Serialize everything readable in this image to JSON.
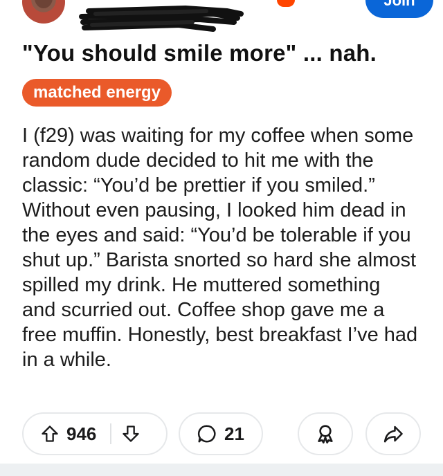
{
  "header": {
    "join_label": "Join"
  },
  "post": {
    "title": "\"You should smile more\" ... nah.",
    "flair": "matched energy",
    "body": "I (f29) was waiting for my coffee when some random dude decided to hit me with the classic: “You’d be prettier if you smiled.” Without even pausing, I looked him dead in the eyes and said: “You’d be tolerable if you shut up.” Barista snorted so hard she almost spilled my drink. He muttered something and scurried out. Coffee shop gave me a free muffin. Honestly, best breakfast I’ve had in a while."
  },
  "actions": {
    "upvote_count": "946",
    "comment_count": "21",
    "icons": {
      "upvote": "upvote-arrow-icon",
      "downvote": "downvote-arrow-icon",
      "comment": "comment-bubble-icon",
      "award": "award-icon",
      "share": "share-arrow-icon"
    }
  },
  "colors": {
    "join_button": "#0a66d8",
    "flair_background": "#ea5a2a",
    "notification": "#ff4500"
  }
}
